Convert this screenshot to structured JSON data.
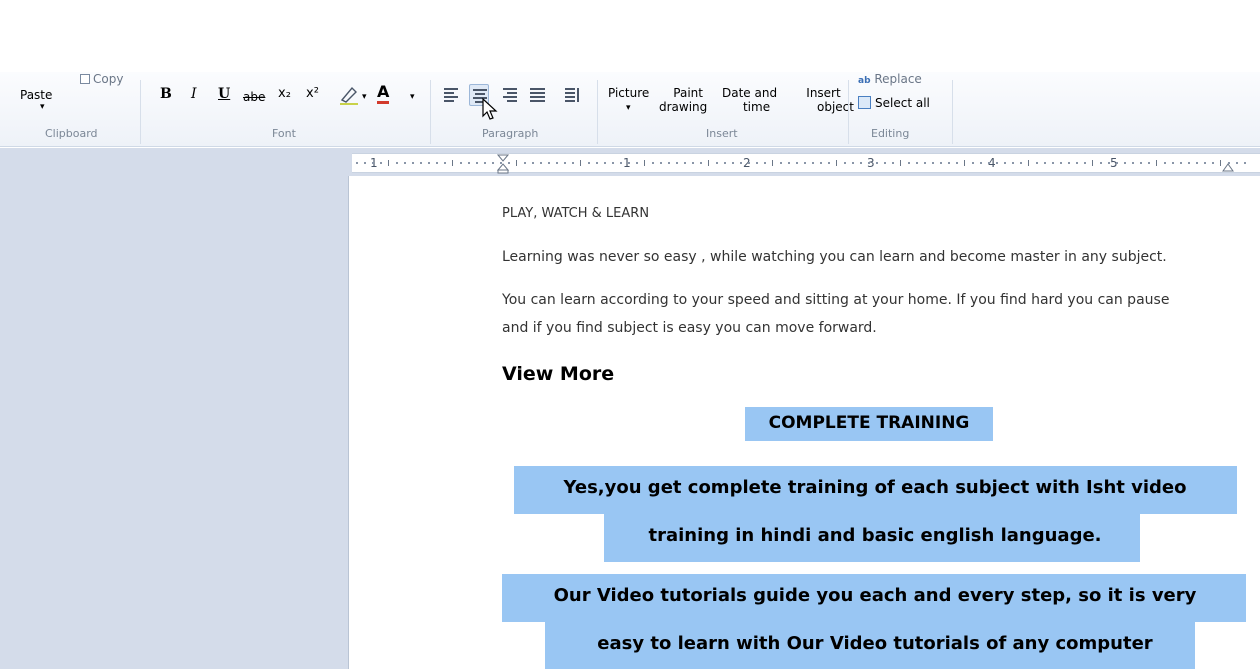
{
  "ribbon": {
    "clipboard": {
      "paste_label": "Paste",
      "copy_label": "Copy",
      "group_label": "Clipboard"
    },
    "font": {
      "bold": "B",
      "italic": "I",
      "underline": "U",
      "strikethrough": "abe",
      "subscript": "x₂",
      "superscript": "x²",
      "font_color": "A",
      "group_label": "Font"
    },
    "paragraph": {
      "group_label": "Paragraph"
    },
    "insert": {
      "picture_label": "Picture",
      "paint_label": "Paint\ndrawing",
      "paint_line1": "Paint",
      "paint_line2": "drawing",
      "datetime_line1": "Date and",
      "datetime_line2": "time",
      "object_line1": "Insert",
      "object_line2": "object",
      "group_label": "Insert"
    },
    "editing": {
      "replace_label": "Replace",
      "select_all_label": "Select all",
      "group_label": "Editing"
    }
  },
  "ruler": {
    "numbers": [
      "1",
      "1",
      "2",
      "3",
      "4",
      "5"
    ]
  },
  "document": {
    "heading": "PLAY, WATCH & LEARN",
    "para1": "Learning was never so easy , while watching you can learn and become master in any subject.",
    "para2_line1": "You can learn according to your speed and sitting at your home. If you find hard you can pause",
    "para2_line2": "and if you find subject is easy you can move forward.",
    "view_more": "View More",
    "complete_training": "COMPLETE TRAINING",
    "yes_line1": "Yes,you get complete training of each subject with Isht video",
    "yes_line2": "training in hindi and basic english language.",
    "our_line1": "Our Video tutorials guide you each and every step, so it is very",
    "our_line2": "easy to learn with Our Video tutorials of any computer"
  },
  "colors": {
    "selection": "#99c6f3",
    "side_pane": "#d4dcea",
    "ribbon": "#eef2f8"
  }
}
